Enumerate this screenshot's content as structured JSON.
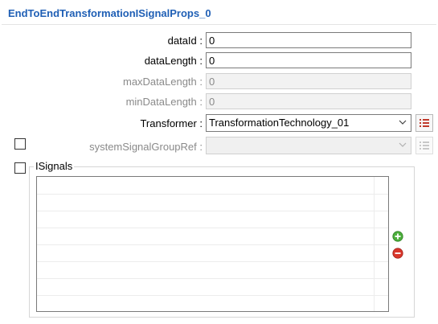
{
  "header": {
    "title": "EndToEndTransformationISignalProps_0"
  },
  "fields": {
    "dataId": {
      "label": "dataId :",
      "value": "0"
    },
    "dataLength": {
      "label": "dataLength :",
      "value": "0"
    },
    "maxDataLength": {
      "label": "maxDataLength :",
      "value": "0"
    },
    "minDataLength": {
      "label": "minDataLength :",
      "value": "0"
    }
  },
  "transformer": {
    "label": "Transformer :",
    "selected": "TransformationTechnology_01"
  },
  "systemSignalGroupRef": {
    "label": "systemSignalGroupRef :",
    "selected": ""
  },
  "isignals": {
    "legend": "ISignals",
    "rows": []
  },
  "colors": {
    "title": "#1f5fb5",
    "add_green": "#4caf3c",
    "remove_red": "#d9362b",
    "list_icon_red": "#c0392b"
  }
}
